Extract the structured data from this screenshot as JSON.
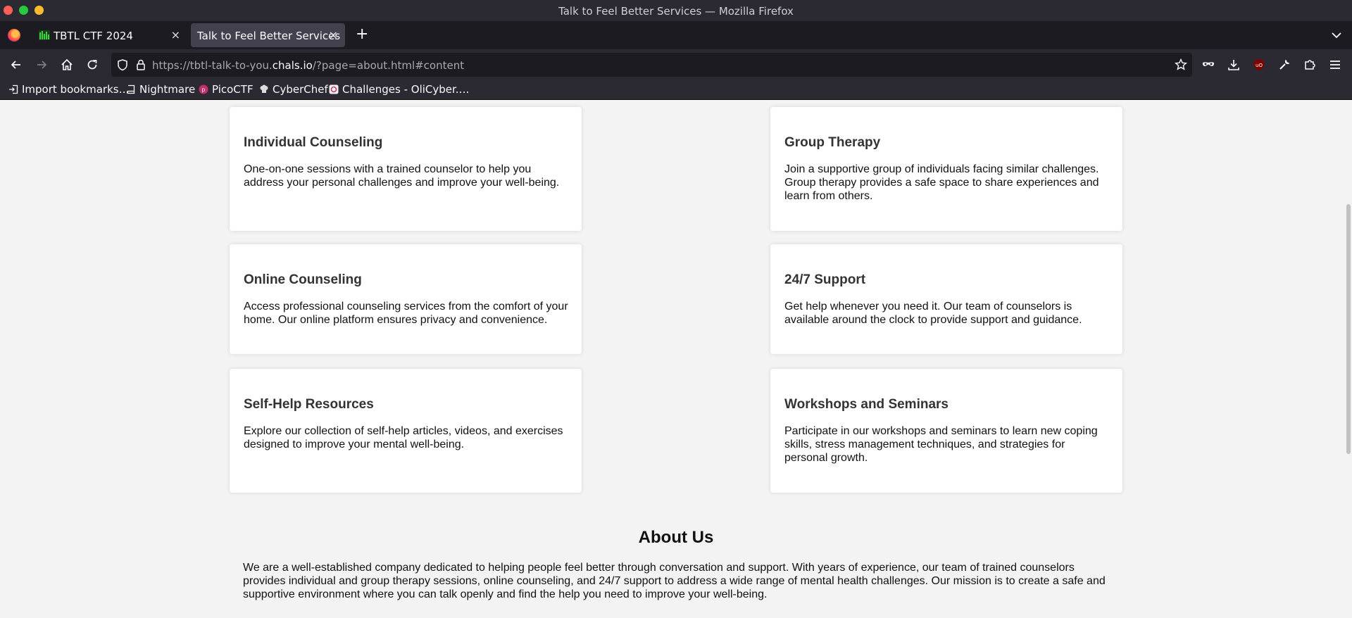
{
  "window": {
    "title": "Talk to Feel Better Services — Mozilla Firefox"
  },
  "tabs": [
    {
      "label": "TBTL CTF 2024",
      "close": "×"
    },
    {
      "label": "Talk to Feel Better Services",
      "close": "×"
    }
  ],
  "new_tab": "+",
  "url": {
    "prefix": "https://tbtl-talk-to-you.",
    "domain": "chals.io",
    "suffix": "/?page=about.html#content"
  },
  "bookmarks": [
    {
      "label": "Import bookmarks…"
    },
    {
      "label": "Nightmare"
    },
    {
      "label": "PicoCTF"
    },
    {
      "label": "CyberChef"
    },
    {
      "label": "Challenges - OliCyber.…"
    }
  ],
  "services": [
    {
      "title": "Individual Counseling",
      "text": "One-on-one sessions with a trained counselor to help you address your personal challenges and improve your well-being."
    },
    {
      "title": "Group Therapy",
      "text": "Join a supportive group of individuals facing similar challenges. Group therapy provides a safe space to share experiences and learn from others."
    },
    {
      "title": "Online Counseling",
      "text": "Access professional counseling services from the comfort of your home. Our online platform ensures privacy and convenience."
    },
    {
      "title": "24/7 Support",
      "text": "Get help whenever you need it. Our team of counselors is available around the clock to provide support and guidance."
    },
    {
      "title": "Self-Help Resources",
      "text": "Explore our collection of self-help articles, videos, and exercises designed to improve your mental well-being."
    },
    {
      "title": "Workshops and Seminars",
      "text": "Participate in our workshops and seminars to learn new coping skills, stress management techniques, and strategies for personal growth."
    }
  ],
  "about": {
    "title": "About Us",
    "text": "We are a well-established company dedicated to helping people feel better through conversation and support. With years of experience, our team of trained counselors provides individual and group therapy sessions, online counseling, and 24/7 support to address a wide range of mental health challenges. Our mission is to create a safe and supportive environment where you can talk openly and find the help you need to improve your well-being."
  },
  "colors": {
    "accent_tab": "#42414d",
    "chrome": "#2b2a33",
    "page_bg": "#f3f3f3"
  }
}
